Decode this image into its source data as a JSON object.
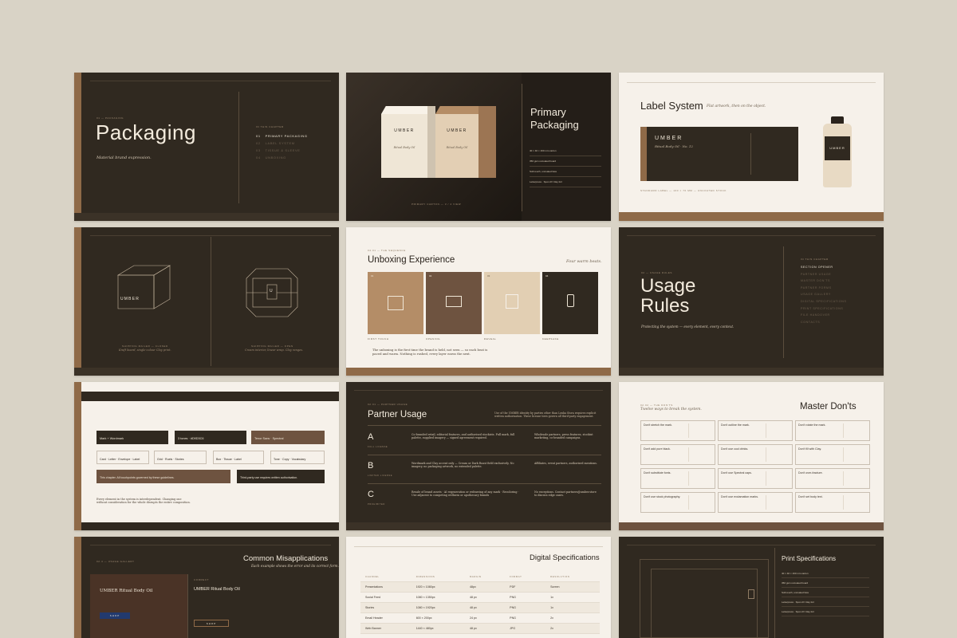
{
  "colors": {
    "background": "#d9d3c6",
    "dark": "#302920",
    "light": "#f6f1ea",
    "accent": "#8f6a48",
    "text_light": "#efe6d6"
  },
  "slide1": {
    "kicker": "01 — PACKAGING",
    "title": "Packaging",
    "subtitle": "Material brand expression.",
    "toc_head": "IN THIS CHAPTER",
    "toc": [
      "PRIMARY PACKAGING",
      "LABEL SYSTEM",
      "TISSUE & SLEEVE",
      "UNBOXING"
    ],
    "toc_nums": [
      "01",
      "02",
      "03",
      "04"
    ]
  },
  "slide2": {
    "box_brand": "UMBER",
    "box_sub": "Ritual Body Oil",
    "title_line1": "Primary",
    "title_line2": "Packaging",
    "specs": [
      "40 × 40 × 160 mm carton",
      "350 gsm uncoated board",
      "Soft-touch, uncoated face",
      "Letterpress · Spot-UV Clay foil"
    ],
    "caption": "PRIMARY CARTON — 3 / 4 VIEW"
  },
  "slide3": {
    "title": "Label System",
    "subtitle": "Flat artwork, then on the object.",
    "label_brand": "UMBER",
    "label_product": "Ritual Body Oil · No. 12",
    "bottle_brand": "UMBER",
    "footer": "STANDARD LABEL — 100 × 70 MM — UNCOATED STOCK"
  },
  "slide4": {
    "box_brand": "UMBER",
    "left_caption": "SHIPPING MAILER — CLOSED",
    "left_note": "Kraft board, single-colour Clay print.",
    "right_caption": "SHIPPING MAILER — OPEN",
    "right_note": "Cream interior, linear wrap. Clay ranges.",
    "mark": "U"
  },
  "slide5": {
    "kicker": "04.01 — THE SEQUENCE",
    "title": "Unboxing Experience",
    "right_note": "Four warm beats.",
    "panels": [
      {
        "num": "01",
        "label": "FIRST TOUCH"
      },
      {
        "num": "02",
        "label": "OPENING"
      },
      {
        "num": "03",
        "label": "REVEAL"
      },
      {
        "num": "04",
        "label": "KEEPSAKE"
      }
    ],
    "note": "The unboxing is the first time the brand is held, not seen — so each beat is paced and warm. Nothing is rushed, every layer earns the next."
  },
  "slide6": {
    "kicker": "02 — USAGE RULES",
    "title_line1": "Usage",
    "title_line2": "Rules",
    "subtitle": "Protecting the system — every element, every context.",
    "toc_head": "IN THIS CHAPTER",
    "toc": [
      "SECTION OPENER",
      "PARTNER USAGE",
      "MASTER DON'TS",
      "PARTNER FORMS",
      "USAGE GALLERY",
      "DIGITAL SPECIFICATIONS",
      "PRINT SPECIFICATIONS",
      "FILE HANDOVER",
      "CONTACTS"
    ]
  },
  "slide7": {
    "boxes": [
      "Mark + Wordmark",
      "3 tones · #D9D3C6",
      "Tenor Sans · Spectral",
      "Card · Letter · Envelope · Label",
      "Grid · Ruels · Stories",
      "Box · Tissue · Label",
      "Tone · Copy · Vocabulary"
    ],
    "wide_text": "This chapter. All touchpoints governed by these guidelines.",
    "right_text": "Third-party use requires written authorisation.",
    "note": "Every element in the system is interdependent. Changing one without consideration for the whole disrupts the entire composition."
  },
  "slide8": {
    "kicker": "02.01 — PARTNER USAGE",
    "title": "Partner Usage",
    "intro": "Use of the UMBER identity by parties other than Lenka Stora requires explicit written authorisation. These license tiers govern all third-party engagement.",
    "tiers": [
      {
        "letter": "A",
        "tag": "FULL LICENSE",
        "body": "Co-branded retail, editorial features, and authorised stockists. Full mark, full palette, supplied imagery — signed agreement required.",
        "right": "Wholesale partners, press features, stockist marketing, co-branded campaigns."
      },
      {
        "letter": "B",
        "tag": "LIMITED LICENSE",
        "body": "Wordmark and Clay accent only — Cream or Dark Roast field exclusively. No imagery, no packaging artwork, no extended palette.",
        "right": "Affiliates, event partners, authorised mentions."
      },
      {
        "letter": "C",
        "tag": "PROHIBITED",
        "body": "Resale of brand assets · AI regeneration or redrawing of any mark · Recoloring · Use adjacent to competing wellness or apothecary brands",
        "right": "No exceptions. Contact partners@umber.store to discuss edge cases."
      }
    ]
  },
  "slide9": {
    "kicker": "02.02 — THE DON'TS",
    "sub": "Twelve ways to break the system.",
    "title": "Master Don'ts",
    "cells": [
      "Don't stretch the mark.",
      "Don't outline the mark.",
      "Don't rotate the mark.",
      "Don't add pure black.",
      "Don't use cool drinks.",
      "Don't fill with Clay.",
      "Don't substitute fonts.",
      "Don't use Spectral caps.",
      "Don't over-fracture.",
      "Don't use stock photography.",
      "Don't use exclamation marks.",
      "Don't set body text."
    ]
  },
  "slide10": {
    "kicker": "02.4 — USAGE GALLERY",
    "title": "Common Misapplications",
    "sub": "Each example shows the error and its correct form.",
    "left_title": "UMBER Ritual Body Oil",
    "right_title": "UMBER Ritual Body Oil",
    "left_btn": "SHOP",
    "right_btn": "SHOP",
    "correct": "CORRECT"
  },
  "slide11": {
    "title": "Digital Specifications",
    "headers": [
      "CHANNEL",
      "DIMENSIONS",
      "MARGIN",
      "FORMAT",
      "RESOLUTION"
    ],
    "rows": [
      [
        "Presentations",
        "1920 × 1080px",
        "48px",
        "PDF",
        "Screen"
      ],
      [
        "Social Feed",
        "1080 × 1350px",
        "48 px",
        "PNG",
        "1x"
      ],
      [
        "Stories",
        "1080 × 1920px",
        "48 px",
        "PNG",
        "1x"
      ],
      [
        "Email Header",
        "600 × 200px",
        "24 px",
        "PNG",
        "2x"
      ],
      [
        "Web Banner",
        "1440 × 480px",
        "48 px",
        "JPG",
        "2x"
      ]
    ]
  },
  "slide12": {
    "title": "Print Specifications",
    "specs": [
      "40 × 40 × 160 mm carton",
      "350 gsm uncoated board",
      "Soft-touch, uncoated face",
      "Letterpress · Spot-UV Clay foil",
      "Letterpress · Spot-UV Clay foil"
    ]
  }
}
